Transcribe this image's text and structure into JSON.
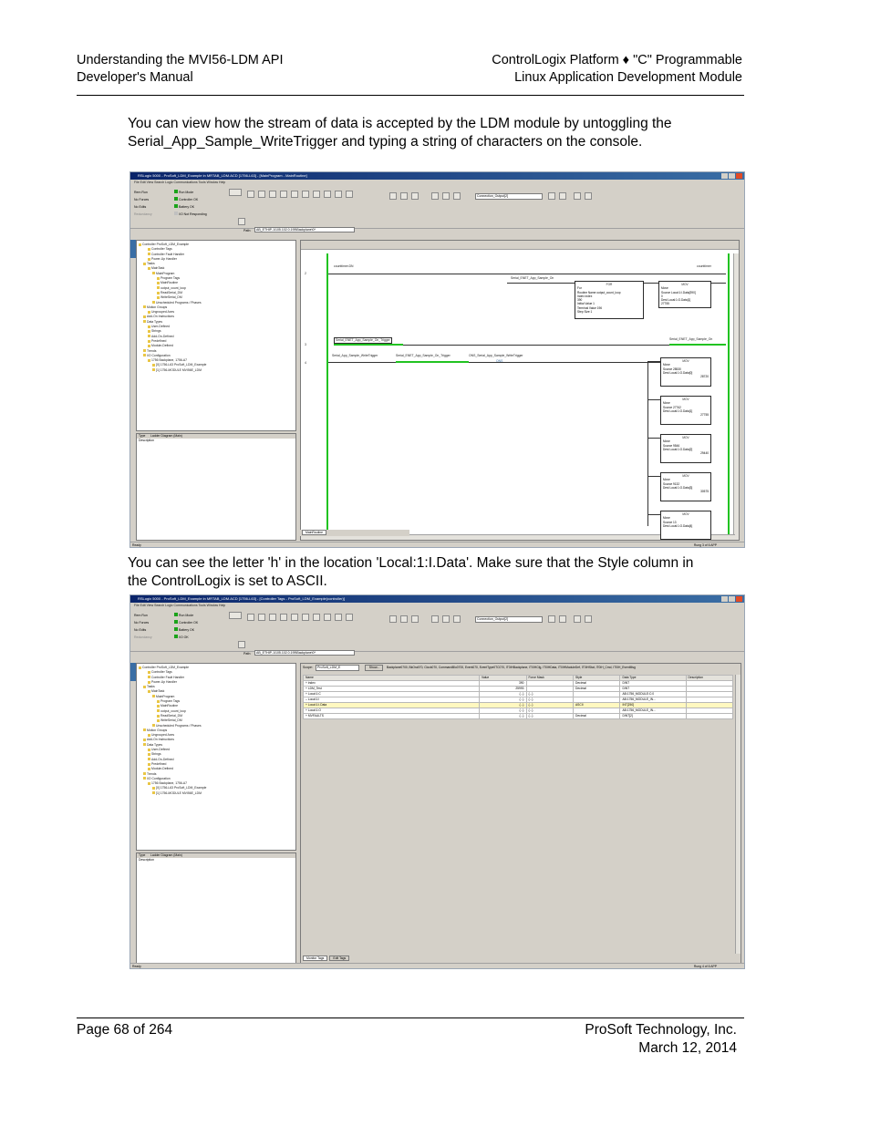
{
  "header": {
    "left_line1": "Understanding the MVI56-LDM API",
    "left_line2": "Developer's Manual",
    "right_line1": "ControlLogix Platform ♦ \"C\" Programmable",
    "right_line2": "Linux Application Development Module"
  },
  "para1": "You can view how the stream of data is accepted by the LDM module by untoggling the Serial_App_Sample_WriteTrigger and typing a string of characters on the console.",
  "para2": "You can see the letter 'h' in the location 'Local:1:I.Data'.  Make sure that the Style column in the ControlLogix is set to ASCII.",
  "screenshot1": {
    "title": "RSLogix 5000 - ProSoft_LDM_Example in MRTAB_LDM.ACD [1756-L63] - [MainProgram - MainRoutine]",
    "menu": "File  Edit  View  Search  Logic  Communications  Tools  Window  Help",
    "status": [
      "Rem Run",
      "No Forces",
      "No Edits",
      "Redundancy"
    ],
    "modes": [
      "Run Mode",
      "Controller OK",
      "Battery OK",
      "I/O Not Responding"
    ],
    "path_label": "Path:",
    "path_value": "AB_ETHIP-1\\105.102.0.195\\Backplane\\0*",
    "combo_tag": "Connection_Output[2]",
    "tree": [
      "Controller ProSoft_LDM_Example",
      "Controller Tags",
      "Controller Fault Handler",
      "Power-Up Handler",
      "Tasks",
      "MainTask",
      "MainProgram",
      "Program Tags",
      "MainRoutine",
      "output_count_loop",
      "ReadSerial_DM",
      "WriteSerial_DM",
      "Unscheduled Programs / Phases",
      "Motion Groups",
      "Ungrouped Axes",
      "Add-On Instructions",
      "Data Types",
      "User-Defined",
      "Strings",
      "Add-On-Defined",
      "Predefined",
      "Module-Defined",
      "Trends",
      "I/O Configuration",
      "1756 Backplane, 1756-A7",
      "[0] 1756-L63 ProSoft_LDM_Example",
      "[1] 1756-MODULE MVI56E_LDM"
    ],
    "info_type": "Type",
    "info_type_val": "Ladder Diagram (Main)",
    "info_desc": "Description",
    "rung2_contact": "counttimer.DN",
    "rung2_coil": "counttimer",
    "rung2_contact2": "Serial_ENET_App_Sample_On",
    "rung2_for": "FOR",
    "rung2_for_lines": [
      "For",
      "Routine Name  output_count_loop",
      "Index              index",
      "                   390",
      "Initial Value       1",
      "Terminal Value    196",
      "Step Size           1"
    ],
    "rung2_mov": "MOV",
    "rung2_mov_lines": [
      "Move",
      "Source   Local:1:I.Data[390]",
      "                     0",
      "Dest     Local:1:O.Data[1]",
      "                 27755"
    ],
    "rung3_contact": "Serial_ENET_App_Sample_On_Trigger",
    "rung3_coil": "Serial_ENET_App_Sample_On",
    "rung4_a": "Serial_App_Sample_WriteTrigger",
    "rung4_b": "Serial_ENET_App_Sample_On_Trigger",
    "rung4_c": "ONS_Serial_App_Sample_WriteTrigger",
    "rung4_ons": "ONS",
    "movs": [
      {
        "src": "28530",
        "dest": "Local:1:O.Data[0]",
        "dest_val": "28720"
      },
      {
        "src": "27762",
        "dest": "Local:1:O.Data[1]",
        "dest_val": "27755"
      },
      {
        "src": "9546",
        "dest": "Local:1:O.Data[2]",
        "dest_val": "29440"
      },
      {
        "src": "9132",
        "dest": "Local:1:O.Data[3]",
        "dest_val": "30575"
      },
      {
        "src": "13",
        "dest": "Local:1:O.Data[4]",
        "dest_val": ""
      }
    ],
    "bottom_tab": "MainRoutine",
    "status_left": "Ready",
    "status_right": "Rung 3 of 6          APP"
  },
  "screenshot2": {
    "title": "RSLogix 5000 - ProSoft_LDM_Example in MRTAB_LDM.ACD [1756-L63] - [Controller Tags - ProSoft_LDM_Example(controller)]",
    "scope_label": "Scope:",
    "scope_value": "ProSoft_LDM_E",
    "show_btn": "Show...",
    "show_text": "Backplane0700, BkOra070, Clock070, CommandBlo0700, Event070, EventType0TC070, IT0IHBackplane, IT0IHCfg, IT0IHData, IT0IHModuleDef, IT0IHStat, IT0IH_Cmd, IT0IH_EventMsg",
    "columns": [
      "Name",
      "Value",
      "Force Mask",
      "Style",
      "Data Type",
      "Description"
    ],
    "rows": [
      {
        "name": "+ index",
        "value": "390",
        "force": "",
        "style": "Decimal",
        "type": "DINT"
      },
      {
        "name": "+ LDM_Test",
        "value": "25993",
        "force": "",
        "style": "Decimal",
        "type": "DINT"
      },
      {
        "name": "+ Local:1:C",
        "value": "{...}",
        "force": "{...}",
        "style": "",
        "type": "AB:1756_MODULE:C:0"
      },
      {
        "name": "– Local:1:I",
        "value": "{...}",
        "force": "{...}",
        "style": "",
        "type": "AB:1756_MODULE_IN..."
      },
      {
        "name": "+ Local:1:I.Data",
        "value": "{...}",
        "force": "{...}",
        "style": "ASCII",
        "type": "INT[250]"
      },
      {
        "name": "+ Local:1:O",
        "value": "{...}",
        "force": "{...}",
        "style": "",
        "type": "AB:1756_MODULE_IN..."
      },
      {
        "name": "+ MVFAULTS",
        "value": "{...}",
        "force": "{...}",
        "style": "Decimal",
        "type": "DINT[2]"
      }
    ],
    "tab_monitor": "Monitor Tags",
    "tab_edit": "Edit Tags",
    "status_left": "Ready",
    "status_right": "Rung 4 of 6          APP"
  },
  "footer": {
    "page": "Page 68 of 264",
    "company": "ProSoft Technology, Inc.",
    "date": "March 12, 2014"
  }
}
